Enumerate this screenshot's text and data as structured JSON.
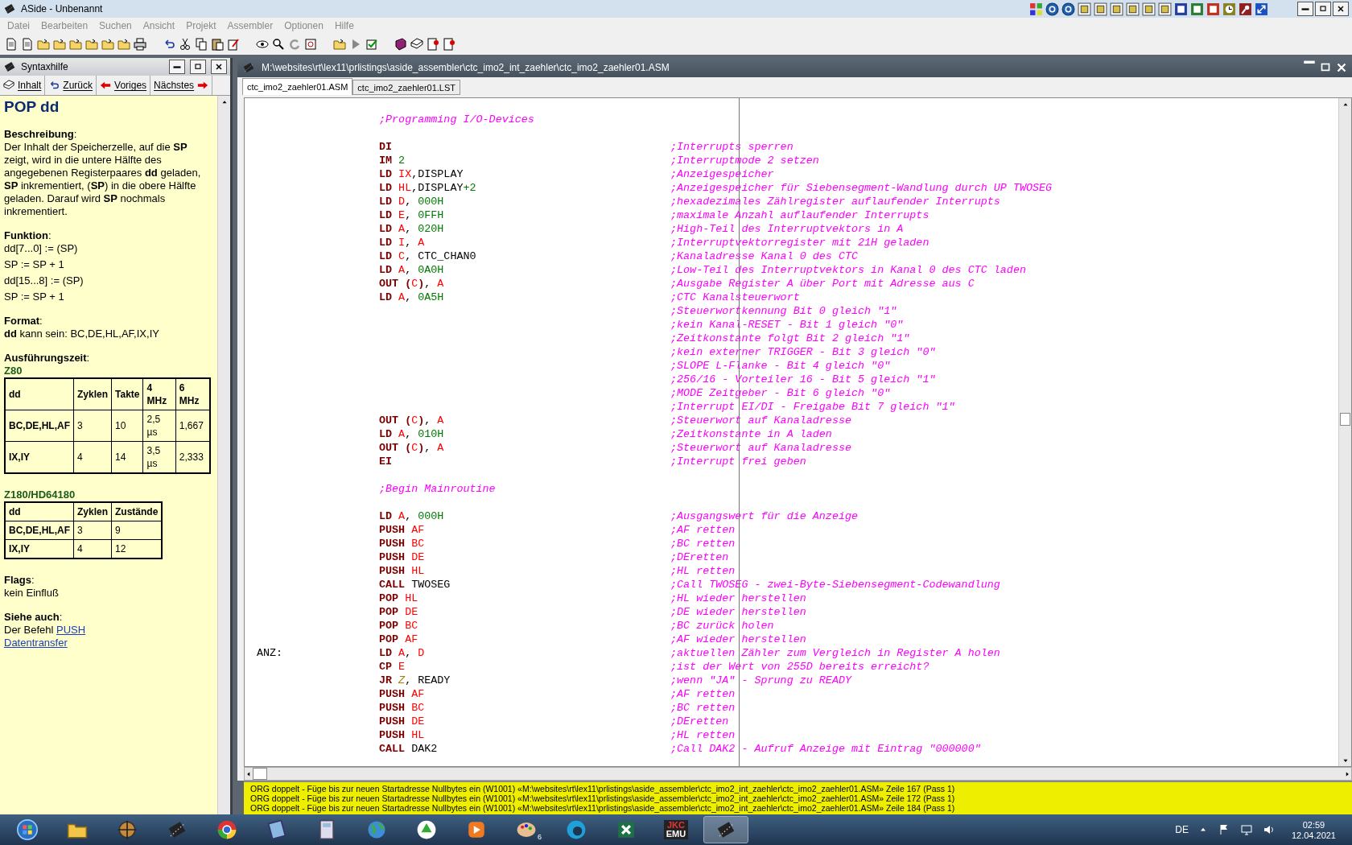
{
  "window": {
    "title": "ASide - Unbenannt"
  },
  "menu": [
    "Datei",
    "Bearbeiten",
    "Suchen",
    "Ansicht",
    "Projekt",
    "Assembler",
    "Optionen",
    "Hilfe"
  ],
  "help_panel": {
    "title": "Syntaxhilfe",
    "nav": [
      {
        "label": "Inhalt",
        "kind": "contents"
      },
      {
        "label": "Zurück",
        "kind": "back"
      },
      {
        "label": "Voriges",
        "kind": "previous"
      },
      {
        "label": "Nächstes",
        "kind": "next"
      }
    ],
    "heading": "POP dd",
    "sections": [
      {
        "title": "**Beschreibung**:",
        "items": [
          {
            "kind": "text",
            "text": "Der Inhalt der Speicherzelle, auf die **SP** zeigt, wird in die untere Hälfte des angegebenen Registerpaares **dd** geladen, **SP** inkrementiert, (**SP**) in die obere Hälfte geladen. Darauf wird **SP** nochmals inkrementiert."
          }
        ]
      },
      {
        "title": "**Funktion**:",
        "items": [
          {
            "kind": "formula",
            "text": "dd[7...0] := (SP)"
          },
          {
            "kind": "formula",
            "text": "SP := SP + 1"
          },
          {
            "kind": "formula",
            "text": "dd[15...8] := (SP)"
          },
          {
            "kind": "formula",
            "text": "SP := SP + 1"
          }
        ]
      },
      {
        "title": "**Format**:",
        "items": [
          {
            "kind": "text",
            "text": "**dd** kann sein: BC,DE,HL,AF,IX,IY"
          }
        ]
      },
      {
        "title": "**Ausführungszeit**:",
        "items": [
          {
            "kind": "table",
            "caption": "Z80",
            "columns": [
              "dd",
              "Zyklen",
              "Takte",
              "4 MHz",
              "6 MHz"
            ],
            "rows": [
              [
                "BC,DE,HL,AF",
                "3",
                "10",
                "2,5 µs",
                "1,667"
              ],
              [
                "IX,IY",
                "4",
                "14",
                "3,5 µs",
                "2,333"
              ]
            ]
          },
          {
            "kind": "table",
            "caption": "Z180/HD64180",
            "columns": [
              "dd",
              "Zyklen",
              "Zustände"
            ],
            "rows": [
              [
                "BC,DE,HL,AF",
                "3",
                "9"
              ],
              [
                "IX,IY",
                "4",
                "12"
              ]
            ]
          }
        ]
      },
      {
        "title": "**Flags**:",
        "items": [
          {
            "kind": "text",
            "text": "kein Einfluß"
          }
        ]
      },
      {
        "title": "**Siehe auch**:",
        "items": [
          {
            "kind": "link",
            "text": "Der Befehl ",
            "link": "PUSH"
          },
          {
            "kind": "link",
            "link": "Datentransfer"
          }
        ]
      }
    ]
  },
  "editor": {
    "title": "M:\\websites\\rt\\lex11\\prlistings\\aside_assembler\\ctc_imo2_int_zaehler\\ctc_imo2_zaehler01.ASM",
    "tabs": [
      {
        "label": "ctc_imo2_zaehler01.ASM",
        "selected": true
      },
      {
        "label": "ctc_imo2_zaehler01.LST",
        "selected": false
      }
    ],
    "lines": [
      {
        "kind": "heading",
        "comment": ";Programming I/O-Devices"
      },
      {
        "kind": "blank"
      },
      {
        "kind": "code",
        "code": [
          {
            "text": "DI",
            "kind": "op"
          }
        ],
        "comment": ";Interrupts sperren"
      },
      {
        "kind": "code",
        "code": [
          {
            "text": "IM ",
            "kind": "op"
          },
          {
            "text": "2",
            "kind": "num"
          }
        ],
        "comment": ";Interruptmode 2 setzen"
      },
      {
        "kind": "code",
        "code": [
          {
            "text": "LD ",
            "kind": "op"
          },
          {
            "text": "IX",
            "kind": "reg"
          },
          {
            "text": ",DISPLAY",
            "kind": "plain"
          }
        ],
        "comment": ";Anzeigespeicher"
      },
      {
        "kind": "code",
        "code": [
          {
            "text": "LD ",
            "kind": "op"
          },
          {
            "text": "HL",
            "kind": "reg"
          },
          {
            "text": ",DISPLAY",
            "kind": "plain"
          },
          {
            "text": "+2",
            "kind": "num"
          }
        ],
        "comment": ";Anzeigespeicher für Siebensegment-Wandlung durch UP TWOSEG"
      },
      {
        "kind": "code",
        "code": [
          {
            "text": "LD ",
            "kind": "op"
          },
          {
            "text": "D",
            "kind": "reg"
          },
          {
            "text": ", ",
            "kind": "plain"
          },
          {
            "text": "000H",
            "kind": "num"
          }
        ],
        "comment": ";hexadezimales Zählregister auflaufender Interrupts"
      },
      {
        "kind": "code",
        "code": [
          {
            "text": "LD ",
            "kind": "op"
          },
          {
            "text": "E",
            "kind": "reg"
          },
          {
            "text": ", ",
            "kind": "plain"
          },
          {
            "text": "0FFH",
            "kind": "num"
          }
        ],
        "comment": ";maximale Anzahl auflaufender Interrupts"
      },
      {
        "kind": "code",
        "code": [
          {
            "text": "LD ",
            "kind": "op"
          },
          {
            "text": "A",
            "kind": "reg"
          },
          {
            "text": ", ",
            "kind": "plain"
          },
          {
            "text": "020H",
            "kind": "num"
          }
        ],
        "comment": ";High-Teil des Interruptvektors in A"
      },
      {
        "kind": "code",
        "code": [
          {
            "text": "LD ",
            "kind": "op"
          },
          {
            "text": "I",
            "kind": "reg"
          },
          {
            "text": ", ",
            "kind": "plain"
          },
          {
            "text": "A",
            "kind": "reg"
          }
        ],
        "comment": ";Interruptvektorregister mit 21H geladen"
      },
      {
        "kind": "code",
        "code": [
          {
            "text": "LD ",
            "kind": "op"
          },
          {
            "text": "C",
            "kind": "reg"
          },
          {
            "text": ", CTC_CHAN0",
            "kind": "plain"
          }
        ],
        "comment": ";Kanaladresse Kanal 0 des CTC"
      },
      {
        "kind": "code",
        "code": [
          {
            "text": "LD ",
            "kind": "op"
          },
          {
            "text": "A",
            "kind": "reg"
          },
          {
            "text": ", ",
            "kind": "plain"
          },
          {
            "text": "0A0H",
            "kind": "num"
          }
        ],
        "comment": ";Low-Teil des Interruptvektors in Kanal 0 des CTC laden"
      },
      {
        "kind": "code",
        "code": [
          {
            "text": "OUT (",
            "kind": "op"
          },
          {
            "text": "C",
            "kind": "reg"
          },
          {
            "text": ")",
            "kind": "op"
          },
          {
            "text": ", ",
            "kind": "plain"
          },
          {
            "text": "A",
            "kind": "reg"
          }
        ],
        "comment": ";Ausgabe Register A über Port mit Adresse aus C"
      },
      {
        "kind": "code",
        "code": [
          {
            "text": "LD ",
            "kind": "op"
          },
          {
            "text": "A",
            "kind": "reg"
          },
          {
            "text": ", ",
            "kind": "plain"
          },
          {
            "text": "0A5H",
            "kind": "num"
          }
        ],
        "comment": ";CTC Kanalsteuerwort"
      },
      {
        "kind": "code",
        "comment": ";Steuerwortkennung Bit 0 gleich \"1\""
      },
      {
        "kind": "code",
        "comment": ";kein Kanal-RESET - Bit 1 gleich \"0\""
      },
      {
        "kind": "code",
        "comment": ";Zeitkonstante folgt Bit 2 gleich \"1\""
      },
      {
        "kind": "code",
        "comment": ";kein externer TRIGGER - Bit 3 gleich \"0\""
      },
      {
        "kind": "code",
        "comment": ";SLOPE L-Flanke - Bit 4 gleich \"0\""
      },
      {
        "kind": "code",
        "comment": ";256/16 - Vorteiler 16 - Bit 5 gleich \"1\""
      },
      {
        "kind": "code",
        "comment": ";MODE Zeitgeber - Bit 6 gleich \"0\""
      },
      {
        "kind": "code",
        "comment": ";Interrupt EI/DI - Freigabe Bit 7 gleich \"1\""
      },
      {
        "kind": "code",
        "code": [
          {
            "text": "OUT (",
            "kind": "op"
          },
          {
            "text": "C",
            "kind": "reg"
          },
          {
            "text": ")",
            "kind": "op"
          },
          {
            "text": ", ",
            "kind": "plain"
          },
          {
            "text": "A",
            "kind": "reg"
          }
        ],
        "comment": ";Steuerwort auf Kanaladresse"
      },
      {
        "kind": "code",
        "code": [
          {
            "text": "LD ",
            "kind": "op"
          },
          {
            "text": "A",
            "kind": "reg"
          },
          {
            "text": ", ",
            "kind": "plain"
          },
          {
            "text": "010H",
            "kind": "num"
          }
        ],
        "comment": ";Zeitkonstante in A laden"
      },
      {
        "kind": "code",
        "code": [
          {
            "text": "OUT (",
            "kind": "op"
          },
          {
            "text": "C",
            "kind": "reg"
          },
          {
            "text": ")",
            "kind": "op"
          },
          {
            "text": ", ",
            "kind": "plain"
          },
          {
            "text": "A",
            "kind": "reg"
          }
        ],
        "comment": ";Steuerwort auf Kanaladresse"
      },
      {
        "kind": "code",
        "code": [
          {
            "text": "EI",
            "kind": "op"
          }
        ],
        "comment": ";Interrupt frei geben"
      },
      {
        "kind": "blank"
      },
      {
        "kind": "heading",
        "comment": ";Begin Mainroutine"
      },
      {
        "kind": "blank"
      },
      {
        "kind": "code",
        "code": [
          {
            "text": "LD ",
            "kind": "op"
          },
          {
            "text": "A",
            "kind": "reg"
          },
          {
            "text": ", ",
            "kind": "plain"
          },
          {
            "text": "000H",
            "kind": "num"
          }
        ],
        "comment": ";Ausgangswert für die Anzeige"
      },
      {
        "kind": "code",
        "code": [
          {
            "text": "PUSH ",
            "kind": "op"
          },
          {
            "text": "AF",
            "kind": "reg"
          }
        ],
        "comment": ";AF retten"
      },
      {
        "kind": "code",
        "code": [
          {
            "text": "PUSH ",
            "kind": "op"
          },
          {
            "text": "BC",
            "kind": "reg"
          }
        ],
        "comment": ";BC retten"
      },
      {
        "kind": "code",
        "code": [
          {
            "text": "PUSH ",
            "kind": "op"
          },
          {
            "text": "DE",
            "kind": "reg"
          }
        ],
        "comment": ";DEretten"
      },
      {
        "kind": "code",
        "code": [
          {
            "text": "PUSH ",
            "kind": "op"
          },
          {
            "text": "HL",
            "kind": "reg"
          }
        ],
        "comment": ";HL retten"
      },
      {
        "kind": "code",
        "code": [
          {
            "text": "CALL ",
            "kind": "op"
          },
          {
            "text": "TWOSEG",
            "kind": "plain"
          }
        ],
        "comment": ";Call TWOSEG - zwei-Byte-Siebensegment-Codewandlung"
      },
      {
        "kind": "code",
        "code": [
          {
            "text": "POP ",
            "kind": "op"
          },
          {
            "text": "HL",
            "kind": "reg"
          }
        ],
        "comment": ";HL wieder herstellen"
      },
      {
        "kind": "code",
        "code": [
          {
            "text": "POP ",
            "kind": "op"
          },
          {
            "text": "DE",
            "kind": "reg"
          }
        ],
        "comment": ";DE wieder herstellen"
      },
      {
        "kind": "code",
        "code": [
          {
            "text": "POP ",
            "kind": "op"
          },
          {
            "text": "BC",
            "kind": "reg"
          }
        ],
        "comment": ";BC zurück holen"
      },
      {
        "kind": "code",
        "code": [
          {
            "text": "POP ",
            "kind": "op"
          },
          {
            "text": "AF",
            "kind": "reg"
          }
        ],
        "comment": ";AF wieder herstellen"
      },
      {
        "kind": "code",
        "label": "ANZ:",
        "code": [
          {
            "text": "LD ",
            "kind": "op"
          },
          {
            "text": "A",
            "kind": "reg"
          },
          {
            "text": ", ",
            "kind": "plain"
          },
          {
            "text": "D",
            "kind": "reg"
          }
        ],
        "comment": ";aktuellen Zähler zum Vergleich in Register A holen"
      },
      {
        "kind": "code",
        "code": [
          {
            "text": "CP ",
            "kind": "op"
          },
          {
            "text": "E",
            "kind": "reg"
          }
        ],
        "comment": ";ist der Wert von 255D bereits erreicht?"
      },
      {
        "kind": "code",
        "code": [
          {
            "text": "JR ",
            "kind": "op"
          },
          {
            "text": "Z",
            "kind": "cond"
          },
          {
            "text": ", READY",
            "kind": "plain"
          }
        ],
        "comment": ";wenn \"JA\" - Sprung zu READY"
      },
      {
        "kind": "code",
        "code": [
          {
            "text": "PUSH ",
            "kind": "op"
          },
          {
            "text": "AF",
            "kind": "reg"
          }
        ],
        "comment": ";AF retten"
      },
      {
        "kind": "code",
        "code": [
          {
            "text": "PUSH ",
            "kind": "op"
          },
          {
            "text": "BC",
            "kind": "reg"
          }
        ],
        "comment": ";BC retten"
      },
      {
        "kind": "code",
        "code": [
          {
            "text": "PUSH ",
            "kind": "op"
          },
          {
            "text": "DE",
            "kind": "reg"
          }
        ],
        "comment": ";DEretten"
      },
      {
        "kind": "code",
        "code": [
          {
            "text": "PUSH ",
            "kind": "op"
          },
          {
            "text": "HL",
            "kind": "reg"
          }
        ],
        "comment": ";HL retten"
      },
      {
        "kind": "code",
        "code": [
          {
            "text": "CALL ",
            "kind": "op"
          },
          {
            "text": "DAK2",
            "kind": "plain"
          }
        ],
        "comment": ";Call DAK2 - Aufruf Anzeige mit Eintrag \"000000\""
      }
    ]
  },
  "messages": [
    "ORG doppelt - Füge bis zur neuen Startadresse Nullbytes ein (W1001) «M:\\websites\\rt\\lex11\\prlistings\\aside_assembler\\ctc_imo2_int_zaehler\\ctc_imo2_zaehler01.ASM» Zeile 167 (Pass 1)",
    "ORG doppelt - Füge bis zur neuen Startadresse Nullbytes ein (W1001) «M:\\websites\\rt\\lex11\\prlistings\\aside_assembler\\ctc_imo2_int_zaehler\\ctc_imo2_zaehler01.ASM» Zeile 172 (Pass 1)",
    "ORG doppelt - Füge bis zur neuen Startadresse Nullbytes ein (W1001) «M:\\websites\\rt\\lex11\\prlistings\\aside_assembler\\ctc_imo2_int_zaehler\\ctc_imo2_zaehler01.ASM» Zeile 184 (Pass 1)"
  ],
  "taskbar": {
    "badge": "6",
    "emulator_label": [
      "JKC",
      "EMU"
    ],
    "language": "DE",
    "time": "02:59",
    "date": "12.04.2021"
  }
}
